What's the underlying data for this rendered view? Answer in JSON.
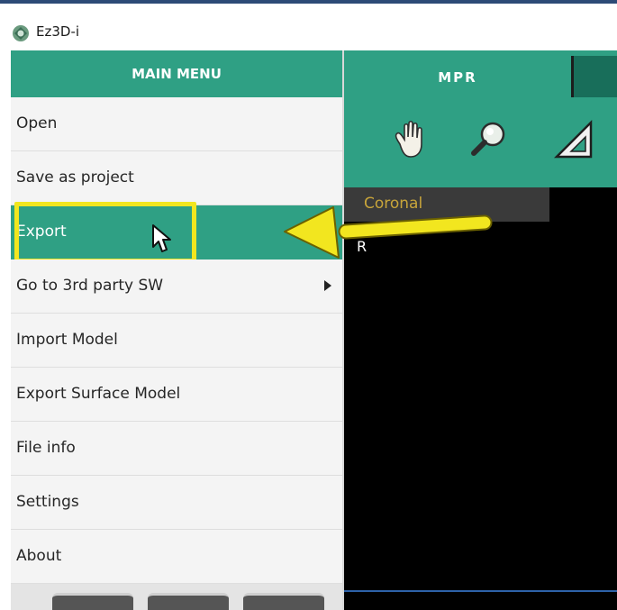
{
  "window": {
    "title": "Ez3D-i",
    "icon": "app-logo-icon"
  },
  "main_menu": {
    "header": "MAIN MENU",
    "items": [
      {
        "label": "Open",
        "has_submenu": false,
        "active": false
      },
      {
        "label": "Save as project",
        "has_submenu": false,
        "active": false
      },
      {
        "label": "Export",
        "has_submenu": false,
        "active": true
      },
      {
        "label": "Go to 3rd party SW",
        "has_submenu": true,
        "active": false
      },
      {
        "label": "Import Model",
        "has_submenu": false,
        "active": false
      },
      {
        "label": "Export Surface Model",
        "has_submenu": false,
        "active": false
      },
      {
        "label": "File info",
        "has_submenu": false,
        "active": false
      },
      {
        "label": "Settings",
        "has_submenu": false,
        "active": false
      },
      {
        "label": "About",
        "has_submenu": false,
        "active": false
      }
    ]
  },
  "viewer": {
    "tab_label": "MPR",
    "tools": [
      "pan-hand-icon",
      "zoom-magnifier-icon",
      "ruler-triangle-icon"
    ],
    "view_label": "Coronal",
    "orientation_label": "R"
  },
  "annotation": {
    "highlight_color": "#f2e61f",
    "arrow_color": "#f2e61f"
  },
  "colors": {
    "accent": "#2fa084",
    "accent_dark": "#186e5a",
    "viewport": "#000000",
    "label_text": "#c8a53a"
  }
}
